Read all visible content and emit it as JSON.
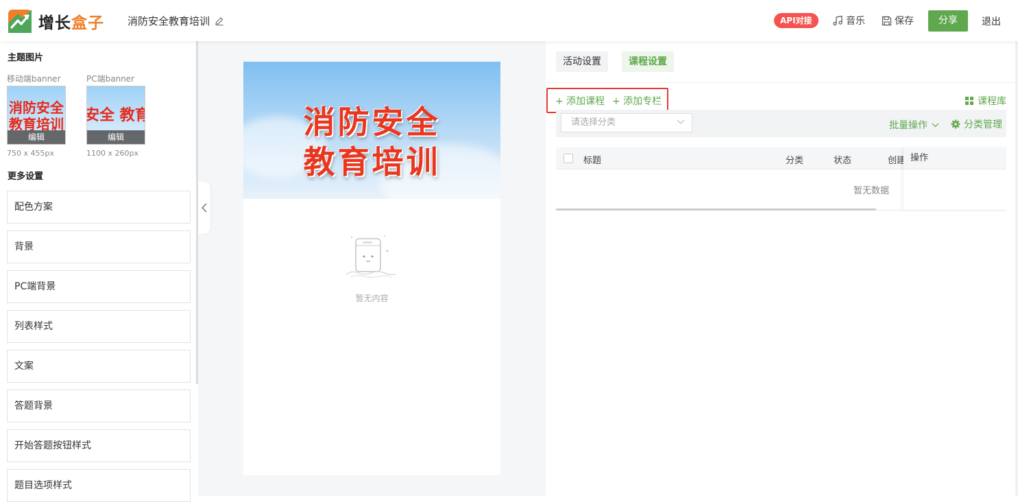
{
  "header": {
    "logo_part1": "增长",
    "logo_part2": "盒子",
    "activity_title": "消防安全教育培训",
    "api_badge": "API对接",
    "music_label": "音乐",
    "save_label": "保存",
    "share_label": "分享",
    "logout_label": "退出",
    "accent_color": "#5fa84e"
  },
  "left": {
    "theme_title": "主题图片",
    "mobile_banner_label": "移动端banner",
    "pc_banner_label": "PC端banner",
    "mobile_thumb_text_line1": "消防安全",
    "mobile_thumb_text_line2": "教育培训",
    "pc_thumb_text": "安全 教育",
    "edit_label": "编辑",
    "mobile_size": "750 x 455px",
    "pc_size": "1100 x 260px",
    "more_title": "更多设置",
    "items": [
      "配色方案",
      "背景",
      "PC端背景",
      "列表样式",
      "文案",
      "答题背景",
      "开始答题按钮样式",
      "题目选项样式"
    ]
  },
  "preview": {
    "banner_line1": "消防安全",
    "banner_line2": "教育培训",
    "empty_text": "暂无内容"
  },
  "right": {
    "tabs": [
      "活动设置",
      "课程设置"
    ],
    "active_tab": "课程设置",
    "add_course": "+ 添加课程",
    "add_column": "+ 添加专栏",
    "course_library": "课程库",
    "category_placeholder": "请选择分类",
    "batch_ops": "批量操作",
    "category_mgmt": "分类管理",
    "columns": [
      "标题",
      "分类",
      "状态",
      "创建",
      "操作"
    ],
    "no_data": "暂无数据"
  }
}
